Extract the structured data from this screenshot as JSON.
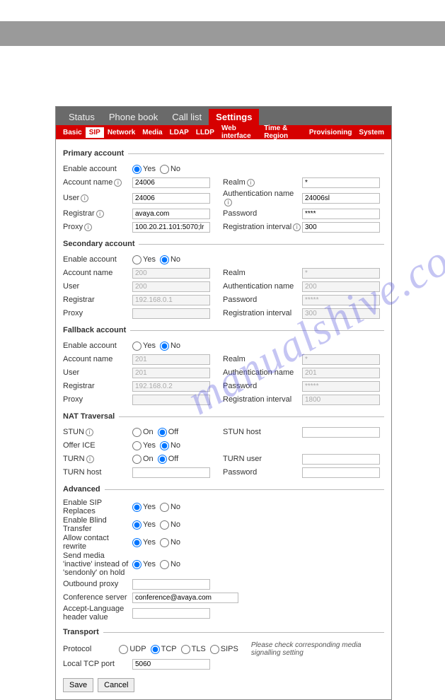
{
  "watermark": "manualshive.com",
  "mainTabs": [
    "Status",
    "Phone book",
    "Call list",
    "Settings"
  ],
  "mainTabActive": 3,
  "subTabs": [
    "Basic",
    "SIP",
    "Network",
    "Media",
    "LDAP",
    "LLDP",
    "Web interface",
    "Time & Region",
    "Provisioning",
    "System"
  ],
  "subTabActive": 1,
  "labels": {
    "yes": "Yes",
    "no": "No",
    "on": "On",
    "off": "Off",
    "primary": "Primary account",
    "secondary": "Secondary account",
    "fallback": "Fallback account",
    "nat": "NAT Traversal",
    "advanced": "Advanced",
    "transport": "Transport",
    "enableAcct": "Enable account",
    "acctName": "Account name",
    "user": "User",
    "registrar": "Registrar",
    "proxy": "Proxy",
    "realm": "Realm",
    "authName": "Authentication name",
    "password": "Password",
    "regInt": "Registration interval",
    "stun": "STUN",
    "stunHost": "STUN host",
    "offerIce": "Offer ICE",
    "turn": "TURN",
    "turnUser": "TURN user",
    "turnHost": "TURN host",
    "turnPw": "Password",
    "enableSipRep": "Enable SIP Replaces",
    "enableBlind": "Enable Blind Transfer",
    "allowContact": "Allow contact rewrite",
    "sendInactive": "Send media 'inactive' instead of 'sendonly' on hold",
    "outboundProxy": "Outbound proxy",
    "confServer": "Conference server",
    "acceptLang": "Accept-Language header value",
    "protocol": "Protocol",
    "udp": "UDP",
    "tcp": "TCP",
    "tls": "TLS",
    "sips": "SIPS",
    "localTcp": "Local TCP port",
    "mediaNote": "Please check corresponding media signalling setting",
    "save": "Save",
    "cancel": "Cancel"
  },
  "primary": {
    "enable": "yes",
    "acctName": "24006",
    "user": "24006",
    "registrar": "avaya.com",
    "proxy": "100.20.21.101:5070;lr",
    "realm": "*",
    "authName": "24006sl",
    "password": "****",
    "regInt": "300"
  },
  "secondary": {
    "enable": "no",
    "acctName": "200",
    "user": "200",
    "registrar": "192.168.0.1",
    "proxy": "",
    "realm": "*",
    "authName": "200",
    "password": "*****",
    "regInt": "300"
  },
  "fallback": {
    "enable": "no",
    "acctName": "201",
    "user": "201",
    "registrar": "192.168.0.2",
    "proxy": "",
    "realm": "*",
    "authName": "201",
    "password": "*****",
    "regInt": "1800"
  },
  "nat": {
    "stun": "off",
    "stunHost": "",
    "offerIce": "no",
    "turn": "off",
    "turnUser": "",
    "turnHost": "",
    "turnPw": ""
  },
  "advanced": {
    "sipReplaces": "yes",
    "blindTransfer": "yes",
    "contactRewrite": "yes",
    "sendInactive": "yes",
    "outboundProxy": "",
    "confServer": "conference@avaya.com",
    "acceptLang": ""
  },
  "transport": {
    "protocol": "tcp",
    "localTcp": "5060"
  }
}
